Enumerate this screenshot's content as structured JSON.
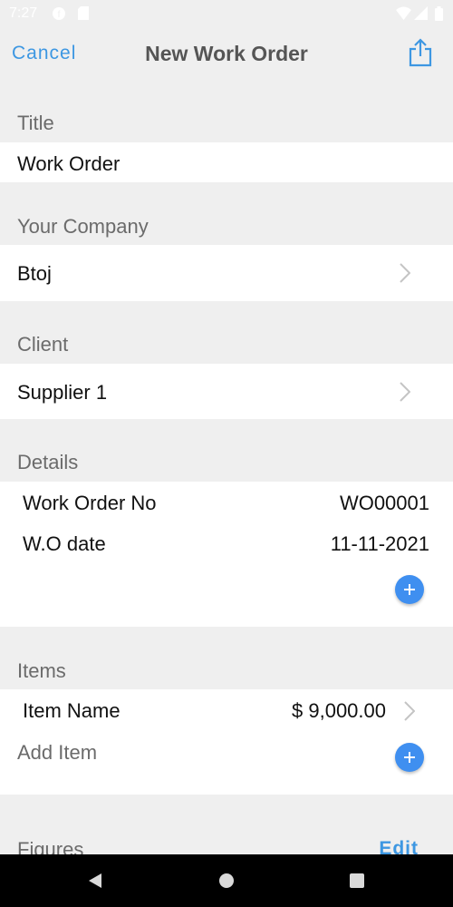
{
  "status_bar": {
    "time": "7:27"
  },
  "header": {
    "cancel_label": "Cancel",
    "title": "New Work Order",
    "share_icon": "share-icon"
  },
  "sections": {
    "title": {
      "header": "Title",
      "value": "Work Order"
    },
    "company": {
      "header": "Your Company",
      "value": "Btoj"
    },
    "client": {
      "header": "Client",
      "value": "Supplier 1"
    },
    "details": {
      "header": "Details",
      "rows": [
        {
          "label": "Work Order No",
          "value": "WO00001"
        },
        {
          "label": "W.O date",
          "value": "11-11-2021"
        }
      ]
    },
    "items": {
      "header": "Items",
      "item_name": "Item Name",
      "item_amount": "$ 9,000.00",
      "add_label": "Add Item"
    },
    "figures": {
      "header": "Figures",
      "edit_label": "Edit"
    }
  },
  "colors": {
    "accent": "#3d97e2",
    "plus_button": "#3f8ff0",
    "background": "#efefef"
  }
}
